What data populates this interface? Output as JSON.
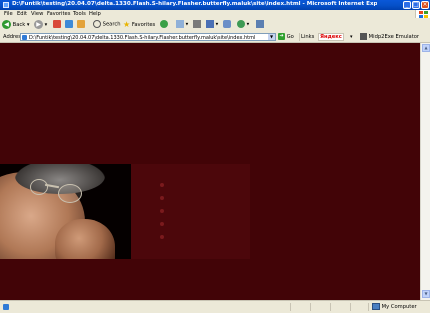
{
  "window": {
    "title": "D:\\Funtik\\testing\\20.04.07\\delta.1330.Flash.S-hilary.Flasher.butterfly.maluk\\site\\index.html - Microsoft Internet Explorer",
    "minimize_label": "_",
    "maximize_label": "□",
    "close_label": "×"
  },
  "menu": {
    "items": [
      "File",
      "Edit",
      "View",
      "Favorites",
      "Tools",
      "Help"
    ]
  },
  "toolbar": {
    "back_label": "Back",
    "search_label": "Search",
    "favorites_label": "Favorites"
  },
  "address": {
    "label": "Address",
    "url": "D:\\Funtik\\testing\\20.04.07\\delta.1330.Flash.S-hilary.Flasher.butterfly.maluk\\site\\index.html",
    "go_label": "Go",
    "links_label": "Links",
    "yandex_label": "Яндекс",
    "emulator_label": "Midp2Exe Emulator"
  },
  "status": {
    "zone": "My Computer"
  },
  "colors": {
    "page_background": "#420407",
    "band": "#4c070b",
    "dots": "#7a1a1d"
  }
}
